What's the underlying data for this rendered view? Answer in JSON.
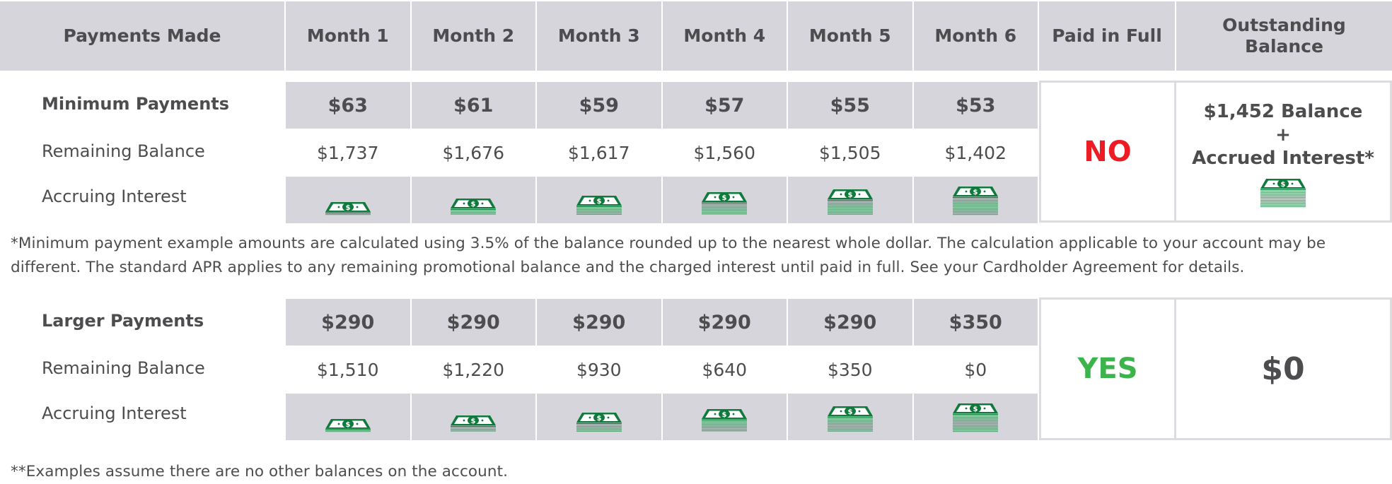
{
  "header": {
    "columns": [
      "Payments Made",
      "Month 1",
      "Month 2",
      "Month 3",
      "Month 4",
      "Month 5",
      "Month 6",
      "Paid in Full",
      "Outstanding\nBalance"
    ]
  },
  "scenarios": [
    {
      "title": "Minimum Payments",
      "balance_label": "Remaining Balance",
      "interest_label": "Accruing Interest",
      "payments": [
        "$63",
        "$61",
        "$59",
        "$57",
        "$55",
        "$53"
      ],
      "balances": [
        "$1,737",
        "$1,676",
        "$1,617",
        "$1,560",
        "$1,505",
        "$1,402"
      ],
      "interest_icon": "money-stack-icon",
      "interest_stack_levels": [
        1,
        2,
        3,
        4,
        5,
        6
      ],
      "paid_in_full": "NO",
      "paid_in_full_color": "#ed1c24",
      "outstanding_balance": "$1,452 Balance\n+\nAccrued Interest*",
      "outstanding_icon": "money-stack-icon",
      "outstanding_stack_level": 6
    },
    {
      "title": "Larger Payments",
      "balance_label": "Remaining Balance",
      "interest_label": "Accruing Interest",
      "payments": [
        "$290",
        "$290",
        "$290",
        "$290",
        "$290",
        "$350"
      ],
      "balances": [
        "$1,510",
        "$1,220",
        "$930",
        "$640",
        "$350",
        "$0"
      ],
      "interest_icon": "money-stack-icon",
      "interest_stack_levels": [
        1,
        2,
        3,
        4,
        5,
        6
      ],
      "paid_in_full": "YES",
      "paid_in_full_color": "#3cb44b",
      "outstanding_balance": "$0"
    }
  ],
  "footnotes": {
    "minimum_payment": "*Minimum payment example amounts are calculated using 3.5% of the balance rounded up to the nearest whole dollar. The calculation applicable to your account may be different. The standard APR applies to any remaining promotional balance and the charged interest until paid in full. See your Cardholder Agreement for details.",
    "assumption": "**Examples assume there are no other balances on the account."
  },
  "colors": {
    "header_fill": "#d5d5db",
    "text": "#4d4d4f",
    "money_green": "#0f7a3c",
    "money_stack": "#5aa478"
  }
}
